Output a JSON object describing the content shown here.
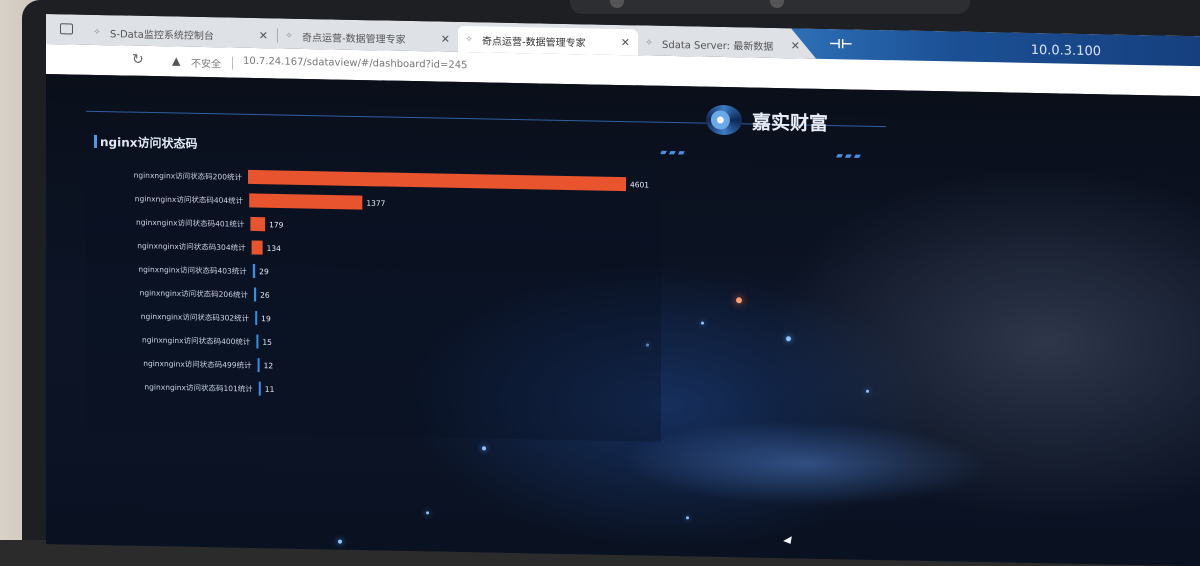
{
  "browser": {
    "tabs": [
      {
        "title": "S-Data监控系统控制台",
        "active": false
      },
      {
        "title": "奇点运营-数据管理专家",
        "active": false
      },
      {
        "title": "奇点运营-数据管理专家",
        "active": true
      },
      {
        "title": "Sdata Server: 最新数据",
        "active": false
      }
    ],
    "security_label": "不安全",
    "url": "10.7.24.167/sdataview/#/dashboard?id=245",
    "ip_banner": "10.0.3.100"
  },
  "dashboard": {
    "brand_name": "嘉实财富",
    "panel_title": "nginx访问状态码"
  },
  "chart_data": {
    "type": "bar",
    "orientation": "horizontal",
    "title": "nginx访问状态码",
    "categories": [
      "nginxnginx访问状态码200统计",
      "nginxnginx访问状态码404统计",
      "nginxnginx访问状态码401统计",
      "nginxnginx访问状态码304统计",
      "nginxnginx访问状态码403统计",
      "nginxnginx访问状态码206统计",
      "nginxnginx访问状态码302统计",
      "nginxnginx访问状态码400统计",
      "nginxnginx访问状态码499统计",
      "nginxnginx访问状态码101统计"
    ],
    "values": [
      4601,
      1377,
      179,
      134,
      29,
      26,
      19,
      15,
      12,
      11
    ],
    "colors": [
      "#e8542e",
      "#e8542e",
      "#e8542e",
      "#e8542e",
      "#3a8ee6",
      "#3a8ee6",
      "#3a8ee6",
      "#3a8ee6",
      "#3a8ee6",
      "#3a8ee6"
    ],
    "grid": false,
    "legend": "none"
  },
  "colors": {
    "bar_high": "#e8542e",
    "bar_low": "#3a8ee6",
    "accent": "#4a9bf0"
  }
}
